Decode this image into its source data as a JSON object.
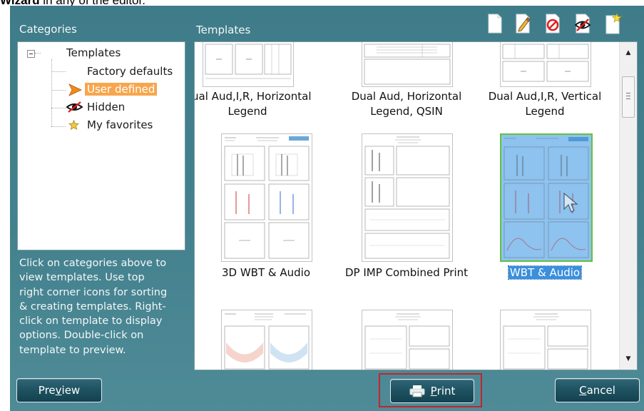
{
  "caption": {
    "bold": "Wizard",
    "rest": " in any of the editor."
  },
  "categories": {
    "header": "Categories",
    "tree": [
      {
        "label": "Templates"
      },
      {
        "label": "Factory defaults"
      },
      {
        "label": "User defined",
        "selected": true
      },
      {
        "label": "Hidden"
      },
      {
        "label": "My favorites"
      }
    ],
    "help_lines": [
      "Click on categories above to",
      "view templates. Use top",
      "right corner icons for sorting",
      "& creating templates. Right-",
      "click on template to display",
      "options. Double-click on",
      "template to preview."
    ]
  },
  "templates": {
    "header": "Templates",
    "toolbar_icons": [
      "new-template-icon",
      "edit-template-icon",
      "delete-template-icon",
      "hide-template-icon",
      "favorite-template-icon"
    ],
    "items": [
      {
        "name_lines": [
          "Dual Aud,I,R, Horizontal",
          "Legend"
        ]
      },
      {
        "name_lines": [
          "Dual Aud, Horizontal",
          "Legend, QSIN"
        ]
      },
      {
        "name_lines": [
          "Dual Aud,I,R, Vertical",
          "Legend"
        ]
      },
      {
        "name_lines": [
          "3D WBT & Audio"
        ]
      },
      {
        "name_lines": [
          "DP IMP Combined Print"
        ]
      },
      {
        "name_lines": [
          "WBT & Audio"
        ],
        "selected": true
      },
      {
        "name_lines": []
      },
      {
        "name_lines": []
      },
      {
        "name_lines": []
      }
    ]
  },
  "buttons": {
    "preview": {
      "pre": "Pre",
      "ul": "v",
      "post": "iew"
    },
    "print": {
      "pre": "",
      "ul": "P",
      "post": "rint"
    },
    "cancel": {
      "pre": "",
      "ul": "C",
      "post": "ancel"
    }
  },
  "colors": {
    "accent": "#f7a64d",
    "selection_blue": "#3a8fde",
    "dialog_teal": "#44818e",
    "button_dark": "#1e5261",
    "highlight_frame": "#c3242f"
  }
}
